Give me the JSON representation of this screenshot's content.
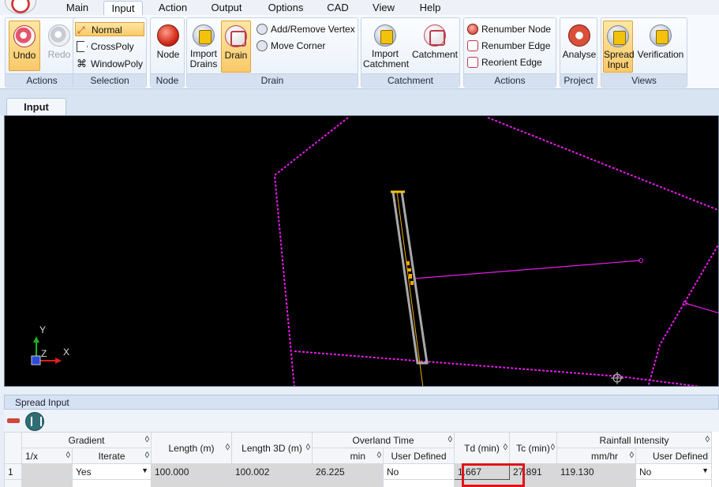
{
  "menu": {
    "tabs": [
      "Main",
      "Input",
      "Action",
      "Output",
      "Options",
      "CAD",
      "View",
      "Help"
    ],
    "active": "Input"
  },
  "ribbon": {
    "actions": {
      "label": "Actions",
      "undo": "Undo",
      "redo": "Redo"
    },
    "selection": {
      "label": "Selection",
      "normal": "Normal",
      "crosspoly": "CrossPoly",
      "windowpoly": "WindowPoly"
    },
    "node": {
      "label": "Node",
      "node": "Node"
    },
    "drain": {
      "label": "Drain",
      "import": "Import Drains",
      "drain": "Drain",
      "add_remove_vertex": "Add/Remove Vertex",
      "move_corner": "Move Corner"
    },
    "catchment": {
      "label": "Catchment",
      "import": "Import Catchment",
      "catchment": "Catchment"
    },
    "actions2": {
      "label": "Actions",
      "renumber_node": "Renumber Node",
      "renumber_edge": "Renumber Edge",
      "reorient_edge": "Reorient Edge"
    },
    "project": {
      "label": "Project",
      "analyse": "Analyse"
    },
    "views": {
      "label": "Views",
      "spread_input": "Spread Input",
      "verification": "Verification"
    }
  },
  "doc_tab": "Input",
  "canvas": {
    "axis_y": "Y",
    "axis_z": "Z",
    "axis_x": "X",
    "line_color": "#e81ce8",
    "drain_color": "#a9a9a9",
    "node_color": "#f2a900"
  },
  "panel": {
    "title": "Spread Input",
    "headers": {
      "gradient": "Gradient",
      "one_over_x": "1/x",
      "iterate": "Iterate",
      "length": "Length (m)",
      "length3d": "Length 3D (m)",
      "overland": "Overland Time",
      "min": "min",
      "user_defined": "User Defined",
      "td": "Td (min)",
      "tc": "Tc (min)",
      "rainfall": "Rainfall Intensity",
      "mmhr": "mm/hr",
      "user_defined2": "User Defined"
    },
    "rows": [
      {
        "num": "1",
        "one_over_x": "",
        "iterate": "Yes",
        "length": "100.000",
        "length3d": "100.002",
        "min": "26.225",
        "user_defined": "No",
        "td": "1.667",
        "tc": "27.891",
        "mmhr": "119.130",
        "user_defined2": "No"
      }
    ]
  }
}
